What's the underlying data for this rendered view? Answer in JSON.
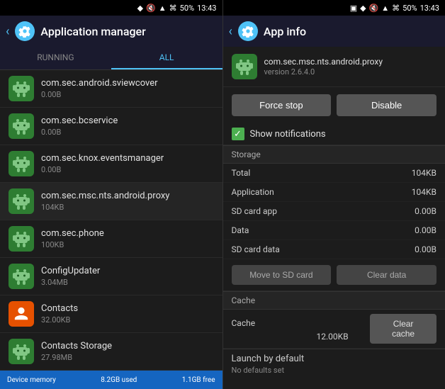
{
  "statusBar": {
    "time": "13:43",
    "battery": "50%",
    "icons": [
      "bluetooth",
      "mute",
      "signal",
      "wifi"
    ]
  },
  "leftPanel": {
    "appBarTitle": "Application manager",
    "tabs": [
      {
        "label": "RUNNING",
        "active": false
      },
      {
        "label": "ALL",
        "active": true
      }
    ],
    "apps": [
      {
        "name": "com.sec.android.sviewcover",
        "size": "0.00B"
      },
      {
        "name": "com.sec.bcservice",
        "size": "0.00B"
      },
      {
        "name": "com.sec.knox.eventsmanager",
        "size": "0.00B"
      },
      {
        "name": "com.sec.msc.nts.android.proxy",
        "size": "104KB"
      },
      {
        "name": "com.sec.phone",
        "size": "100KB"
      },
      {
        "name": "ConfigUpdater",
        "size": "3.04MB"
      },
      {
        "name": "Contacts",
        "size": "32.00KB",
        "type": "orange"
      },
      {
        "name": "Contacts Storage",
        "size": "27.98MB"
      }
    ],
    "bottomBar": {
      "used": "8.2GB used",
      "free": "1.1GB free",
      "label": "Device memory"
    }
  },
  "rightPanel": {
    "appBarTitle": "App info",
    "appName": "com.sec.msc.nts.android.proxy",
    "appVersion": "version 2.6.4.0",
    "buttons": {
      "forceStop": "Force stop",
      "disable": "Disable"
    },
    "showNotifications": "Show notifications",
    "sections": {
      "storage": {
        "label": "Storage",
        "rows": [
          {
            "label": "Total",
            "value": "104KB"
          },
          {
            "label": "Application",
            "value": "104KB"
          },
          {
            "label": "SD card app",
            "value": "0.00B"
          },
          {
            "label": "Data",
            "value": "0.00B"
          },
          {
            "label": "SD card data",
            "value": "0.00B"
          }
        ],
        "moveToSDCard": "Move to SD card",
        "clearData": "Clear data"
      },
      "cache": {
        "label": "Cache",
        "cacheLabel": "Cache",
        "cacheValue": "12.00KB",
        "clearCache": "Clear cache"
      },
      "launchByDefault": {
        "title": "Launch by default",
        "subtitle": "No defaults set"
      }
    }
  }
}
